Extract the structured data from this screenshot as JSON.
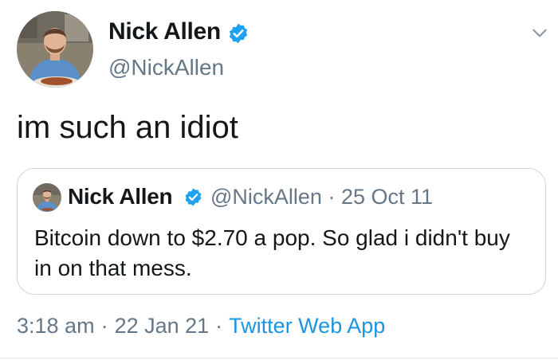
{
  "tweet": {
    "author": {
      "name": "Nick Allen",
      "handle": "@NickAllen",
      "verified": true
    },
    "text": "im such an idiot",
    "quoted": {
      "name": "Nick Allen",
      "handle": "@NickAllen",
      "dot": "·",
      "date": "25 Oct 11",
      "text": "Bitcoin down to $2.70 a pop. So glad i didn't buy in on that mess."
    },
    "footer": {
      "time": "3:18 am",
      "sep1": "·",
      "date": "22 Jan 21",
      "sep2": "·",
      "source": "Twitter Web App"
    }
  },
  "icons": {
    "verified": "verified-badge-icon",
    "menu": "chevron-down-icon"
  },
  "colors": {
    "text": "#14171a",
    "secondary": "#657786",
    "link": "#1b95e0",
    "verified": "#1da1f2",
    "border": "#ccd6dd"
  }
}
